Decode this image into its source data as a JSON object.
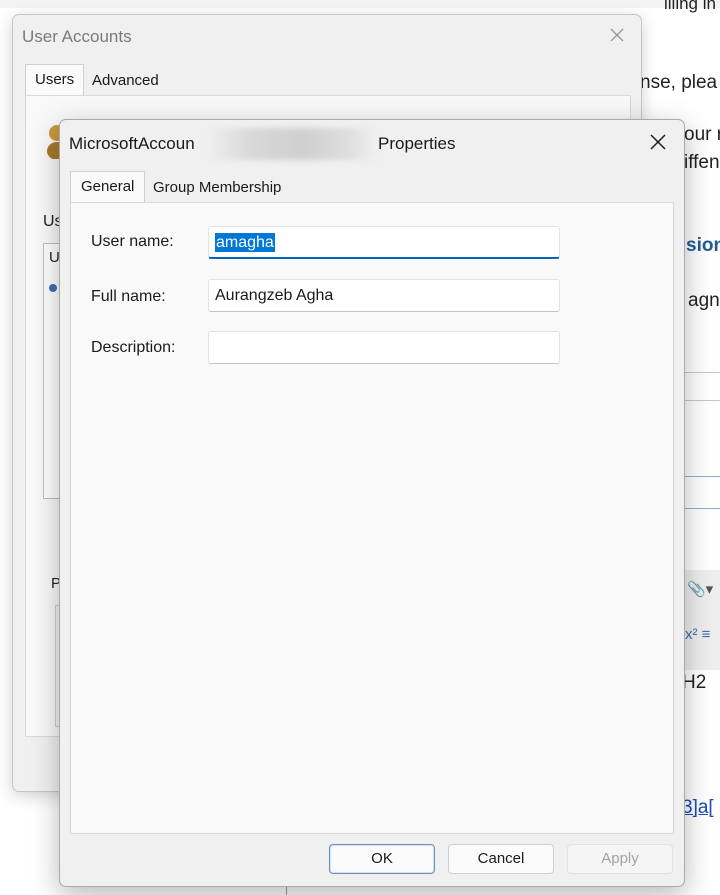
{
  "background_doc": {
    "fragments": [
      "nse, plea",
      "our r",
      "iffen",
      "sion",
      "agn",
      "H2",
      "3]a[",
      "illing in"
    ]
  },
  "user_accounts": {
    "title": "User Accounts",
    "tabs": [
      {
        "label": "Users"
      },
      {
        "label": "Advanced"
      }
    ],
    "users_label": "Us",
    "list_first_letter": "U",
    "bottom_label": "P"
  },
  "dialog": {
    "title_prefix": "MicrosoftAccoun",
    "title_suffix": "Properties",
    "tabs": [
      {
        "label": "General"
      },
      {
        "label": "Group Membership"
      }
    ],
    "fields": {
      "username": {
        "label": "User name:",
        "value": "amagha"
      },
      "fullname": {
        "label": "Full name:",
        "value": "Aurangzeb Agha"
      },
      "description": {
        "label": "Description:",
        "value": ""
      }
    },
    "buttons": {
      "ok": "OK",
      "cancel": "Cancel",
      "apply": "Apply"
    }
  },
  "colors": {
    "accent": "#0078d4",
    "focus_underline": "#0067c0"
  }
}
